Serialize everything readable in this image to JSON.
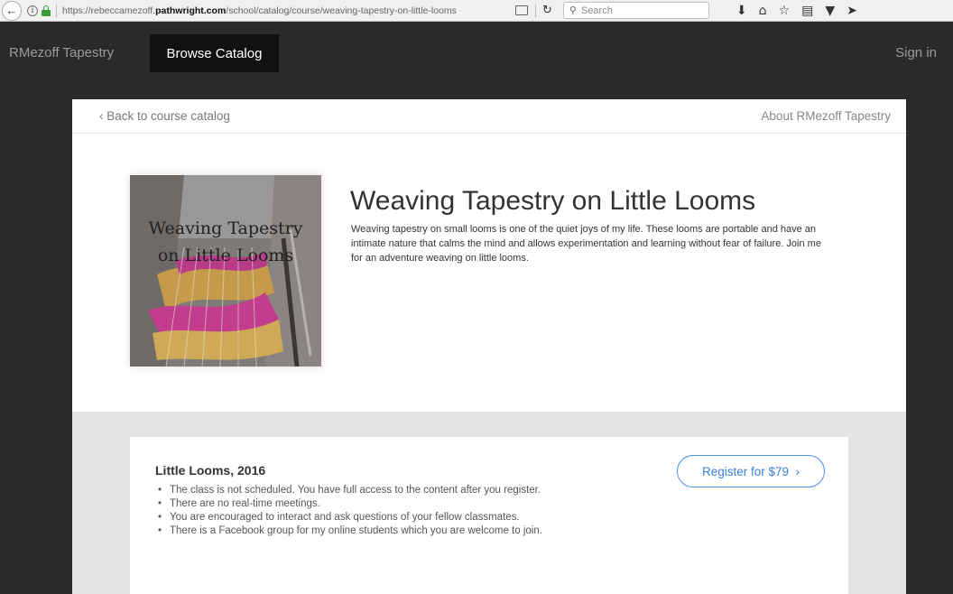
{
  "browser": {
    "url_prefix": "https://rebeccamezoff.",
    "url_domain": "pathwright.com",
    "url_path": "/school/catalog/course/weaving-tapestry-on-little-looms",
    "search_placeholder": "Search"
  },
  "header": {
    "brand": "RMezoff Tapestry",
    "browse_tab": "Browse Catalog",
    "sign_in": "Sign in"
  },
  "card": {
    "back_link": "Back to course catalog",
    "about_link": "About RMezoff Tapestry"
  },
  "course": {
    "image_line1": "Weaving Tapestry",
    "image_line2": "on Little Looms",
    "title": "Weaving Tapestry on Little Looms",
    "description": "Weaving tapestry on small looms is one of the quiet joys of my life. These looms are portable and have an intimate nature that calms the mind and allows experimentation and learning without fear of failure. Join me for an adventure weaving on little looms."
  },
  "offering": {
    "title": "Little Looms, 2016",
    "register_label": "Register for $79",
    "bullets": [
      "The class is not scheduled. You have full access to the content after you register.",
      "There are no real-time meetings.",
      "You are encouraged to interact and ask questions of your fellow classmates.",
      "There is a Facebook group for my online students which you are welcome to join."
    ]
  },
  "colors": {
    "accent": "#3a82d8",
    "header_bg": "#2a2a2a",
    "active_tab_bg": "#111111"
  },
  "icons": {
    "back": "back-arrow-icon",
    "info": "info-icon",
    "lock": "lock-icon",
    "reader": "reader-view-icon",
    "reload": "reload-icon",
    "search": "search-icon",
    "download": "download-icon",
    "home": "home-icon",
    "bookmark": "bookmark-star-icon",
    "library": "library-icon",
    "pocket": "pocket-icon",
    "send": "send-icon"
  }
}
